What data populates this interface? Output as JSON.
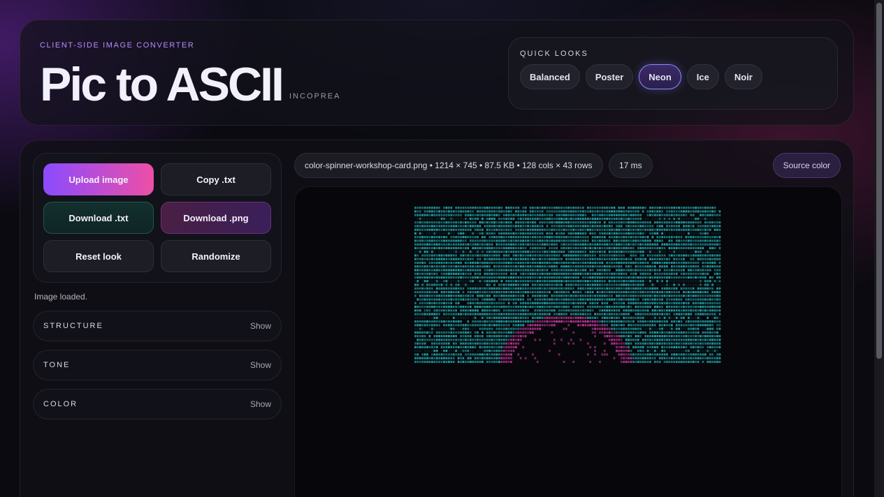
{
  "header": {
    "eyebrow": "CLIENT-SIDE IMAGE CONVERTER",
    "title": "Pic to ASCII",
    "brand": "INCOPREA"
  },
  "quick_looks": {
    "title": "QUICK LOOKS",
    "options": [
      "Balanced",
      "Poster",
      "Neon",
      "Ice",
      "Noir"
    ],
    "active": "Neon"
  },
  "actions": {
    "upload": "Upload image",
    "copy_txt": "Copy .txt",
    "download_txt": "Download .txt",
    "download_png": "Download .png",
    "reset": "Reset look",
    "randomize": "Randomize"
  },
  "status": "Image loaded.",
  "sections": [
    {
      "label": "STRUCTURE",
      "toggle": "Show"
    },
    {
      "label": "TONE",
      "toggle": "Show"
    },
    {
      "label": "COLOR",
      "toggle": "Show"
    }
  ],
  "preview_meta": {
    "file_info": "color-spinner-workshop-card.png • 1214 × 745 • 87.5 KB • 128 cols × 43 rows",
    "timing": "17 ms",
    "source_color": "Source color"
  },
  "colors": {
    "ascii_primary": "#1fa4a8",
    "ascii_accent": "#c2399a",
    "accent_purple": "#8a4bff",
    "accent_pink": "#ee4fa6"
  }
}
